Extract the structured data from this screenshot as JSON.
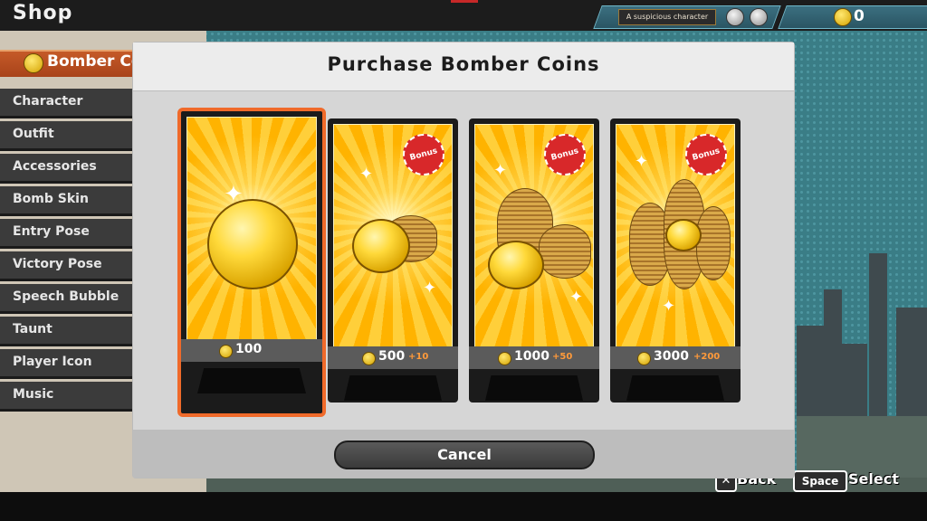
{
  "header": {
    "title": "Shop",
    "player_name": "A suspicious character",
    "coin_balance": "0"
  },
  "sidebar": {
    "category_banner": "Bomber Coins",
    "items": [
      {
        "label": "Character"
      },
      {
        "label": "Outfit"
      },
      {
        "label": "Accessories"
      },
      {
        "label": "Bomb Skin"
      },
      {
        "label": "Entry Pose"
      },
      {
        "label": "Victory Pose"
      },
      {
        "label": "Speech Bubble"
      },
      {
        "label": "Taunt"
      },
      {
        "label": "Player Icon"
      },
      {
        "label": "Music"
      }
    ]
  },
  "dialog": {
    "title": "Purchase Bomber Coins",
    "bonus_seal_label": "Bonus",
    "cancel_label": "Cancel",
    "packs": [
      {
        "amount": "100",
        "bonus": "",
        "selected": true
      },
      {
        "amount": "500",
        "bonus": "+10",
        "selected": false
      },
      {
        "amount": "1000",
        "bonus": "+50",
        "selected": false
      },
      {
        "amount": "3000",
        "bonus": "+200",
        "selected": false
      }
    ]
  },
  "hints": {
    "back_label": "Back",
    "space_key": "Space",
    "select_label": "Select"
  },
  "colors": {
    "selection_border": "#f06a2a",
    "accent_gold": "#ffc21a",
    "bonus_text": "#ff9a3a"
  }
}
